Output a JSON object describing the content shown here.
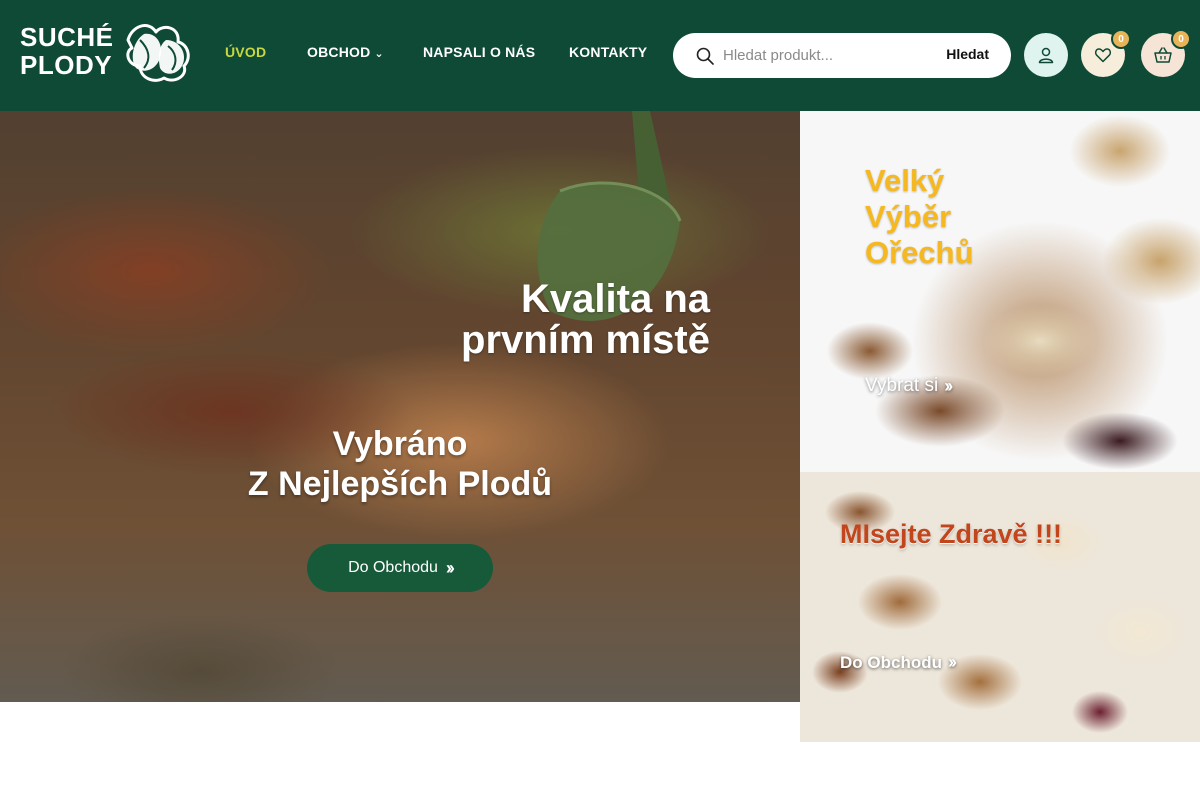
{
  "brand": {
    "line1": "SUCHÉ",
    "line2": "PLODY"
  },
  "nav": {
    "items": [
      {
        "label": "ÚVOD",
        "active": true
      },
      {
        "label": "OBCHOD",
        "active": false,
        "dropdown": true
      },
      {
        "label": "NAPSALI O NÁS",
        "active": false
      },
      {
        "label": "KONTAKTY",
        "active": false
      }
    ]
  },
  "search": {
    "placeholder": "Hledat produkt...",
    "button": "Hledat"
  },
  "header_icons": {
    "account": "user-icon",
    "wishlist": {
      "icon": "heart-icon",
      "count": "0"
    },
    "cart": {
      "icon": "basket-icon",
      "count": "0"
    }
  },
  "hero": {
    "title_line1": "Kvalita na",
    "title_line2": "prvním místě",
    "subtitle_line1": "Vybráno",
    "subtitle_line2": "Z Nejlepších Plodů",
    "button": "Do Obchodu"
  },
  "promo1": {
    "title_line1": "Velký",
    "title_line2": "Výběr",
    "title_line3": "Ořechů",
    "link": "Vybrat si"
  },
  "promo2": {
    "title": "MIsejte Zdravě !!!",
    "link": "Do Obchodu"
  },
  "colors": {
    "header_bg": "#0e4a35",
    "nav_active": "#c8d83e",
    "button_green": "#165a3a",
    "accent_yellow": "#f5b820",
    "accent_red": "#c2451c",
    "badge": "#e8b45a"
  }
}
